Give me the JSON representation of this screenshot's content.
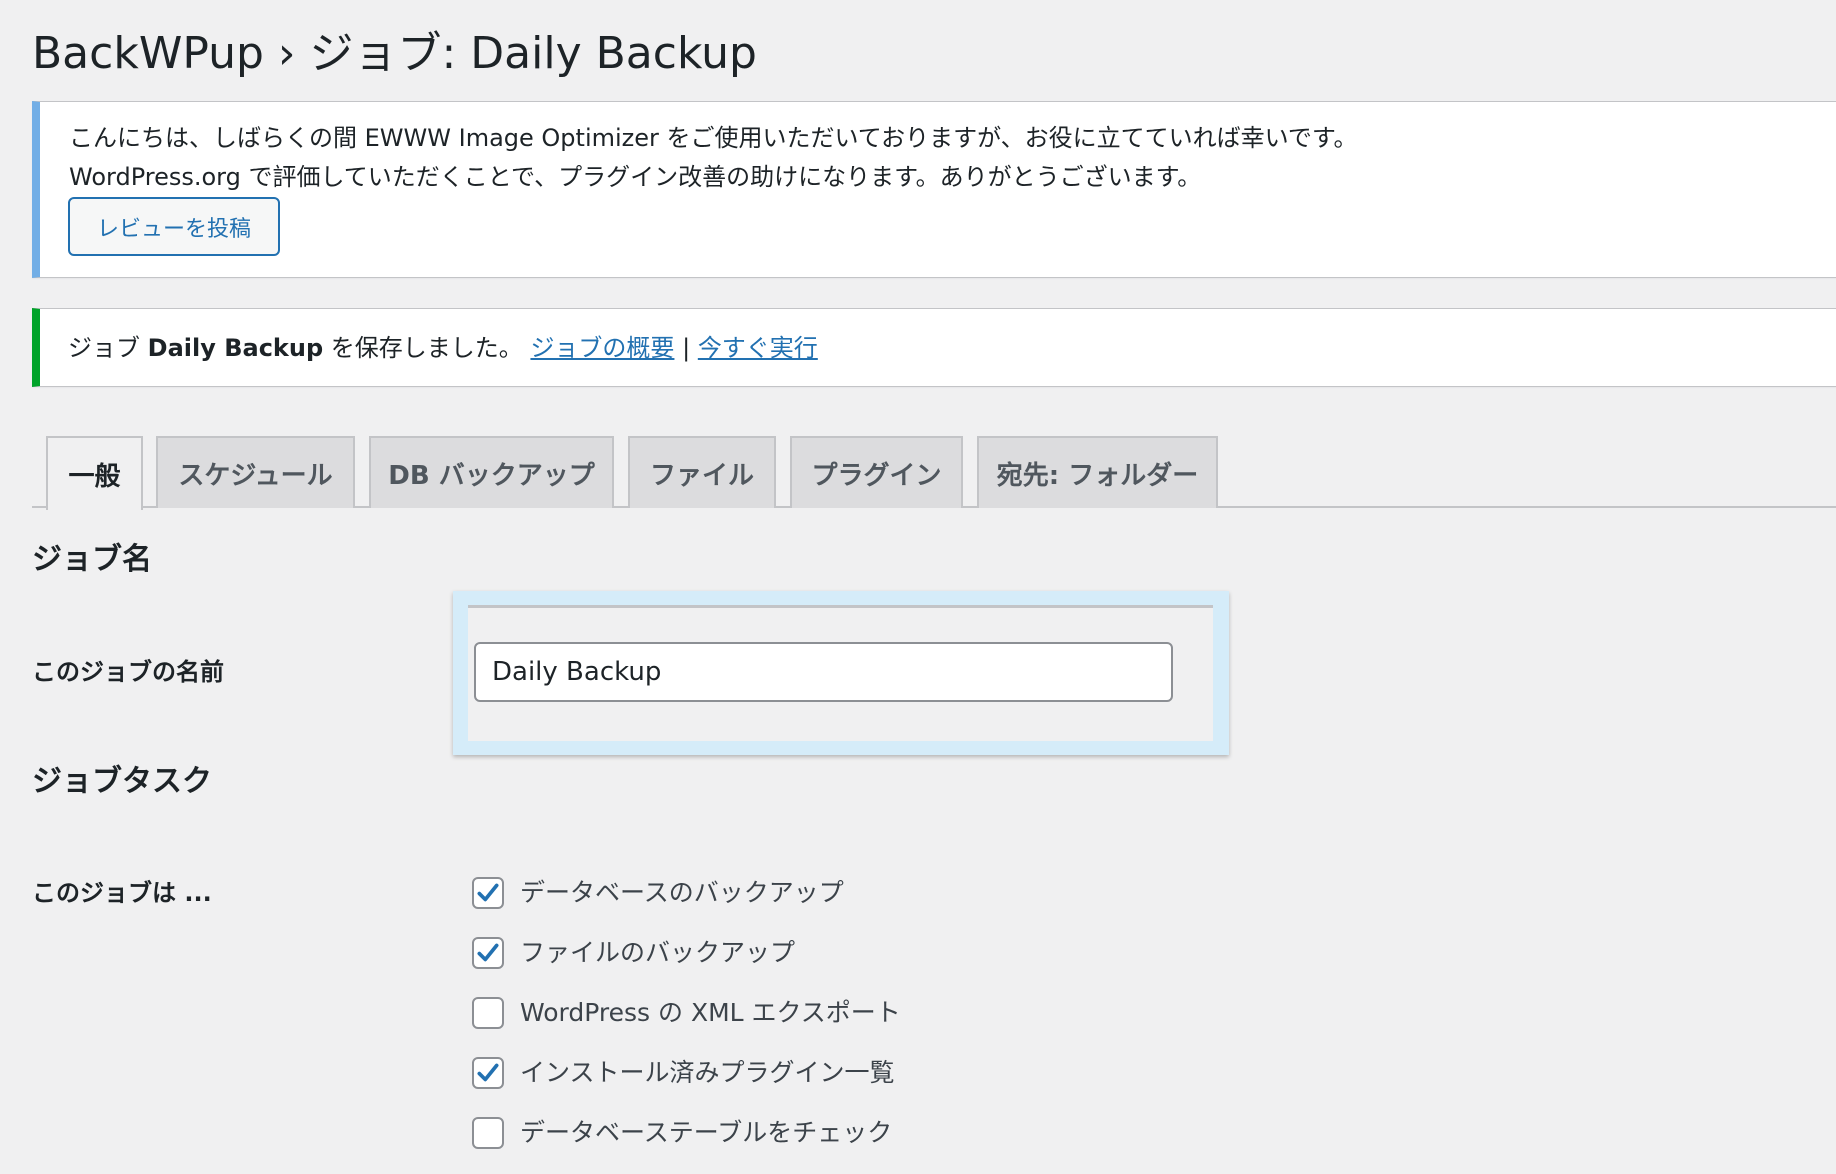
{
  "header": {
    "title": "BackWPup › ジョブ: Daily Backup"
  },
  "review_notice": {
    "line1": "こんにちは、しばらくの間 EWWW Image Optimizer をご使用いただいておりますが、お役に立てていれば幸いです。",
    "line2": "WordPress.org で評価していただくことで、プラグイン改善の助けになります。ありがとうございます。",
    "button_label": "レビューを投稿",
    "accent_color": "#72aee6"
  },
  "success_notice": {
    "prefix": "ジョブ",
    "job_name": "Daily Backup",
    "suffix": "を保存しました。",
    "link_overview": "ジョブの概要",
    "separator": "|",
    "link_run": "今すぐ実行",
    "accent_color": "#00a32a"
  },
  "tabs": [
    {
      "label": "一般",
      "active": true
    },
    {
      "label": "スケジュール",
      "active": false
    },
    {
      "label": "DB バックアップ",
      "active": false
    },
    {
      "label": "ファイル",
      "active": false
    },
    {
      "label": "プラグイン",
      "active": false
    },
    {
      "label": "宛先: フォルダー",
      "active": false
    }
  ],
  "job_name_section": {
    "title": "ジョブ名",
    "field_label": "このジョブの名前",
    "field_value": "Daily Backup"
  },
  "job_tasks_section": {
    "title": "ジョブタスク",
    "row_label": "このジョブは ...",
    "tasks": [
      {
        "label": "データベースのバックアップ",
        "checked": true
      },
      {
        "label": "ファイルのバックアップ",
        "checked": true
      },
      {
        "label": "WordPress の XML エクスポート",
        "checked": false
      },
      {
        "label": "インストール済みプラグイン一覧",
        "checked": true
      },
      {
        "label": "データベーステーブルをチェック",
        "checked": false
      }
    ]
  },
  "colors": {
    "link": "#2271b1",
    "checkmark": "#2271b1",
    "highlight": "#d5ecf9"
  }
}
